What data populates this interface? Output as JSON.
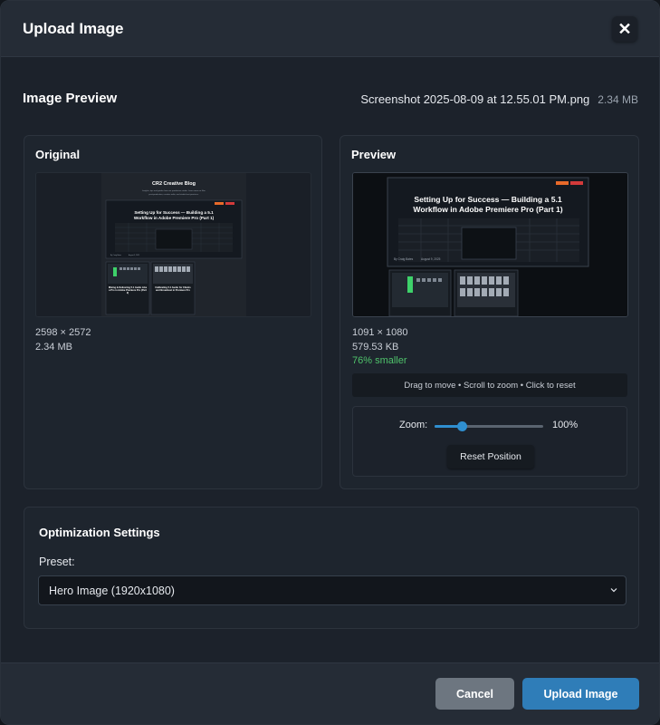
{
  "modal": {
    "title": "Upload Image",
    "close_label": "✕"
  },
  "preview_section": {
    "title": "Image Preview",
    "file_name": "Screenshot 2025-08-09 at 12.55.01 PM.png",
    "file_size": "2.34 MB"
  },
  "original": {
    "label": "Original",
    "dimensions": "2598 × 2572",
    "size": "2.34 MB",
    "thumbnail": {
      "blog_name": "CR2 Creative Blog",
      "tagline_line1": "Insights, tips and guides from our production studio. Learn more on filter",
      "tagline_line2": "post-production, creative edits, and studio best practices.",
      "hero_title_line1": "Setting Up for Success — Building a 5.1",
      "hero_title_line2": "Workflow in Adobe Premiere Pro (Part 1)",
      "hero_byline": "By Craig Bates",
      "hero_date": "August 9, 2025",
      "card1_title": "Mixing & Delivering 5.1 Audio Like a Pro in Adobe Premiere Pro (Part 2)",
      "card2_title": "Calibrating 5.1 Audio for Clients and Broadcast in Premiere Pro"
    }
  },
  "preview": {
    "label": "Preview",
    "dimensions": "1091 × 1080",
    "size": "579.53 KB",
    "savings": "76% smaller",
    "hint": "Drag to move • Scroll to zoom • Click to reset",
    "thumbnail": {
      "hero_title_line1": "Setting Up for Success — Building a 5.1",
      "hero_title_line2": "Workflow in Adobe Premiere Pro (Part 1)",
      "hero_byline": "By Craig Bates",
      "hero_date": "August 9, 2025"
    },
    "zoom": {
      "label": "Zoom:",
      "value": "100%",
      "level": 0.25
    },
    "reset_label": "Reset Position"
  },
  "settings": {
    "title": "Optimization Settings",
    "preset_label": "Preset:",
    "preset_value": "Hero Image (1920x1080)"
  },
  "footer": {
    "cancel_label": "Cancel",
    "upload_label": "Upload Image"
  },
  "colors": {
    "accent": "#2f7db8",
    "success": "#4fc36b",
    "background": "#1c222b"
  }
}
